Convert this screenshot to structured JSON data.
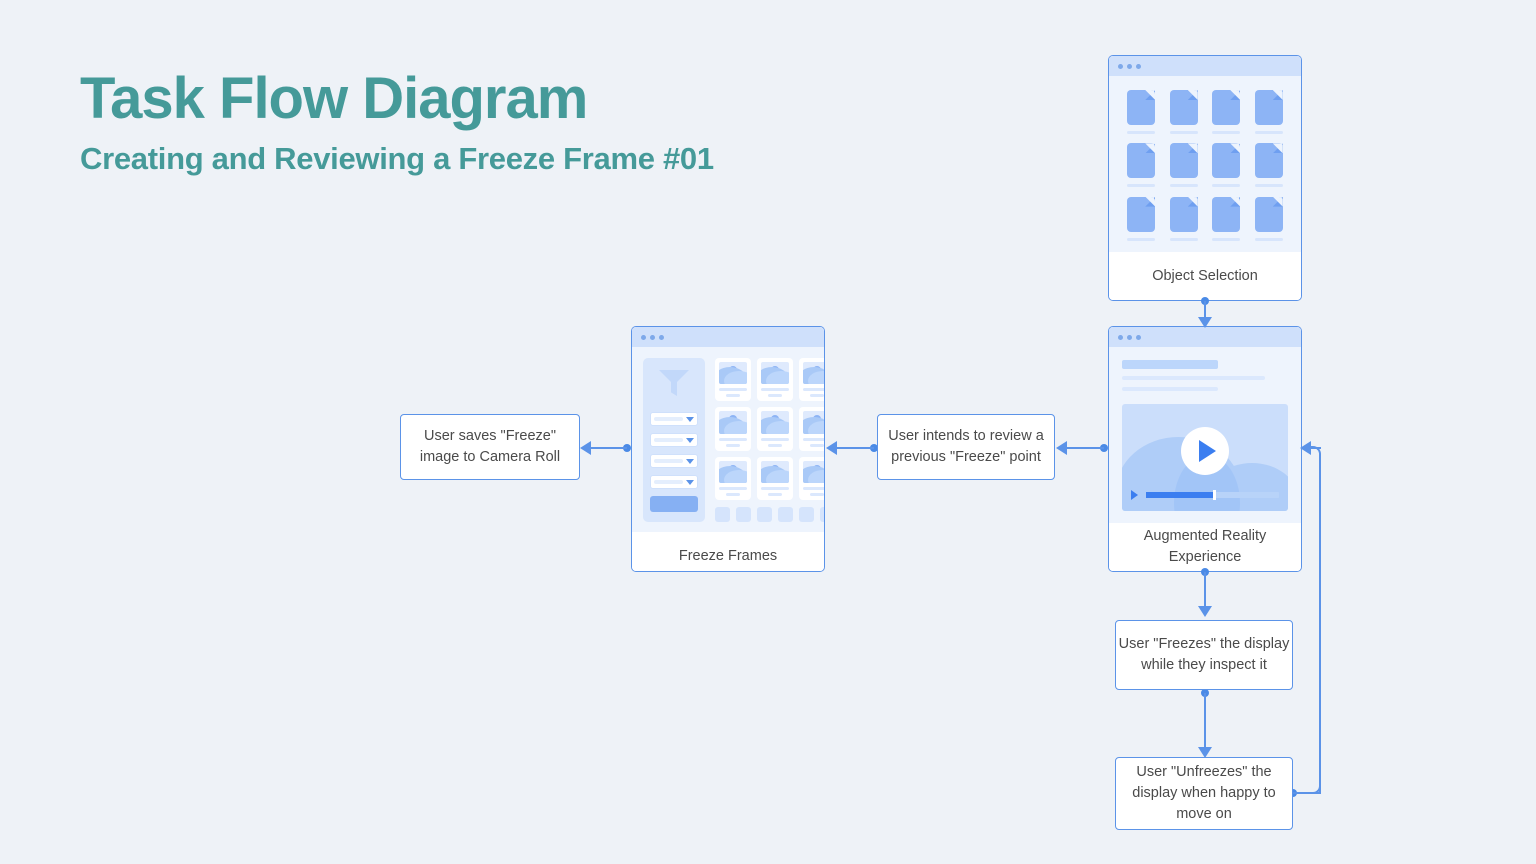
{
  "header": {
    "title": "Task Flow Diagram",
    "subtitle": "Creating and Reviewing a Freeze Frame #01"
  },
  "theme": {
    "background": "#eef2f7",
    "title_color": "#459a99",
    "connector_color": "#5b93e8",
    "box_border": "#5b93e8",
    "box_text": "#4a4a4a",
    "accent_blue": "#3b7ef0",
    "mockup_blue": "#8db4f5",
    "mockup_bg": "#eef4fd"
  },
  "screens": [
    {
      "id": "object-selection",
      "label": "Object Selection",
      "type": "grid-of-documents",
      "rows": 3,
      "columns": 4,
      "item_icon": "document-icon"
    },
    {
      "id": "augmented-reality-experience",
      "label": "Augmented Reality Experience",
      "type": "video-player",
      "play_button_icon": "play-icon",
      "progress_percent": 50
    },
    {
      "id": "freeze-frames",
      "label": "Freeze Frames",
      "type": "filtered-gallery",
      "filter_icon": "funnel-icon",
      "dropdown_count": 4,
      "thumbnail_rows": 3,
      "thumbnail_columns": 3,
      "pagination_items": 6
    }
  ],
  "process_boxes": [
    {
      "id": "save-freeze-image",
      "lines": [
        "User saves \"Freeze\"",
        "image to Camera Roll"
      ]
    },
    {
      "id": "review-previous-freeze",
      "lines": [
        "User intends to review a",
        "previous \"Freeze\" point"
      ]
    },
    {
      "id": "freeze-display",
      "lines": [
        "User \"Freezes\" the display",
        "while they inspect it"
      ]
    },
    {
      "id": "unfreeze-display",
      "lines": [
        "User \"Unfreezes\" the",
        "display when happy to",
        "move on"
      ]
    }
  ],
  "connectors": [
    {
      "id": "object-selection-to-ar",
      "from": "object-selection",
      "to": "augmented-reality-experience",
      "direction": "down"
    },
    {
      "id": "ar-to-review-previous",
      "from": "augmented-reality-experience",
      "to": "review-previous-freeze",
      "direction": "left"
    },
    {
      "id": "review-previous-to-freeze-frames",
      "from": "review-previous-freeze",
      "to": "freeze-frames",
      "direction": "left"
    },
    {
      "id": "freeze-frames-to-save-image",
      "from": "freeze-frames",
      "to": "save-freeze-image",
      "direction": "left"
    },
    {
      "id": "ar-to-freeze-display",
      "from": "augmented-reality-experience",
      "to": "freeze-display",
      "direction": "down"
    },
    {
      "id": "freeze-display-to-unfreeze",
      "from": "freeze-display",
      "to": "unfreeze-display",
      "direction": "down"
    },
    {
      "id": "unfreeze-loop-back-to-ar",
      "from": "unfreeze-display",
      "to": "augmented-reality-experience",
      "direction": "loop-right-up-left"
    }
  ]
}
